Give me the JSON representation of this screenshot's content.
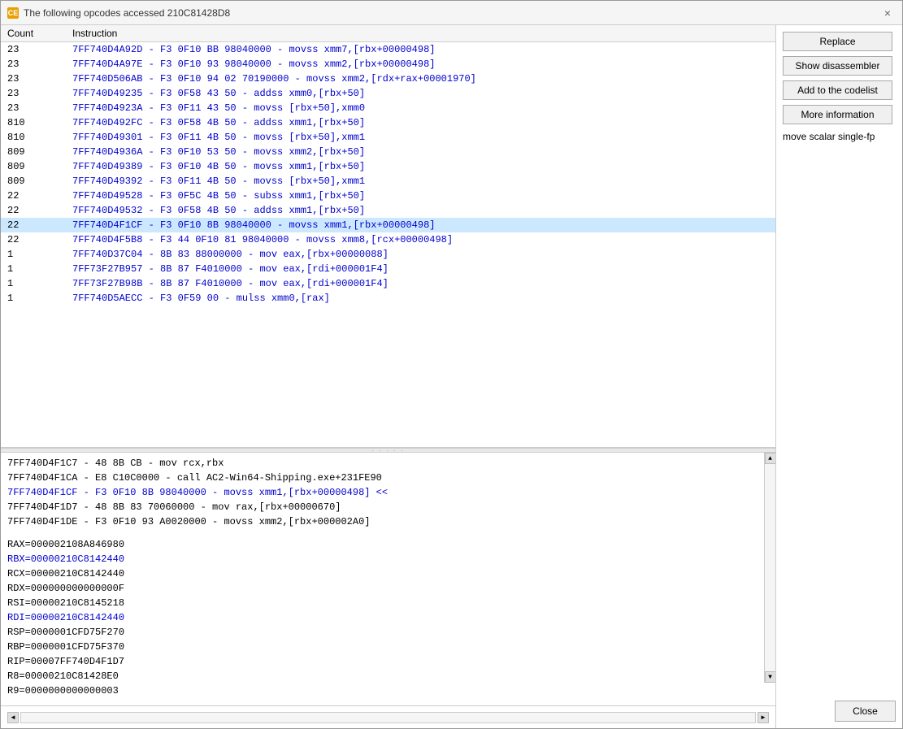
{
  "window": {
    "title": "The following opcodes accessed 210C81428D8",
    "title_icon": "CE",
    "close_label": "×"
  },
  "table": {
    "headers": [
      "Count",
      "Instruction"
    ],
    "rows": [
      {
        "count": "23",
        "instruction": "7FF740D4A92D - F3 0F10 BB 98040000  - movss xmm7,[rbx+00000498]",
        "highlighted": false
      },
      {
        "count": "23",
        "instruction": "7FF740D4A97E - F3 0F10 93 98040000  - movss xmm2,[rbx+00000498]",
        "highlighted": false
      },
      {
        "count": "23",
        "instruction": "7FF740D506AB - F3 0F10 94 02 70190000  - movss xmm2,[rdx+rax+00001970]",
        "highlighted": false
      },
      {
        "count": "23",
        "instruction": "7FF740D49235 - F3 0F58 43 50  - addss xmm0,[rbx+50]",
        "highlighted": false
      },
      {
        "count": "23",
        "instruction": "7FF740D4923A - F3 0F11 43 50  - movss [rbx+50],xmm0",
        "highlighted": false
      },
      {
        "count": "810",
        "instruction": "7FF740D492FC - F3 0F58 4B 50  - addss xmm1,[rbx+50]",
        "highlighted": false
      },
      {
        "count": "810",
        "instruction": "7FF740D49301 - F3 0F11 4B 50  - movss [rbx+50],xmm1",
        "highlighted": false
      },
      {
        "count": "809",
        "instruction": "7FF740D4936A - F3 0F10 53 50  - movss xmm2,[rbx+50]",
        "highlighted": false
      },
      {
        "count": "809",
        "instruction": "7FF740D49389 - F3 0F10 4B 50  - movss xmm1,[rbx+50]",
        "highlighted": false
      },
      {
        "count": "809",
        "instruction": "7FF740D49392 - F3 0F11 4B 50  - movss [rbx+50],xmm1",
        "highlighted": false
      },
      {
        "count": "22",
        "instruction": "7FF740D49528 - F3 0F5C 4B 50  - subss xmm1,[rbx+50]",
        "highlighted": false
      },
      {
        "count": "22",
        "instruction": "7FF740D49532 - F3 0F58 4B 50  - addss xmm1,[rbx+50]",
        "highlighted": false
      },
      {
        "count": "22",
        "instruction": "7FF740D4F1CF - F3 0F10 8B 98040000  - movss xmm1,[rbx+00000498]",
        "highlighted": true
      },
      {
        "count": "22",
        "instruction": "7FF740D4F5B8 - F3 44 0F10 81 98040000  - movss xmm8,[rcx+00000498]",
        "highlighted": false
      },
      {
        "count": "1",
        "instruction": "7FF740D37C04 - 8B 83 88000000  - mov eax,[rbx+00000088]",
        "highlighted": false
      },
      {
        "count": "1",
        "instruction": "7FF73F27B957 - 8B 87 F4010000  - mov eax,[rdi+000001F4]",
        "highlighted": false
      },
      {
        "count": "1",
        "instruction": "7FF73F27B98B - 8B 87 F4010000  - mov eax,[rdi+000001F4]",
        "highlighted": false
      },
      {
        "count": "1",
        "instruction": "7FF740D5AECC - F3 0F59 00  - mulss xmm0,[rax]",
        "highlighted": false
      }
    ]
  },
  "disasm": {
    "lines": [
      {
        "text": "7FF740D4F1C7 - 48 8B CB  - mov rcx,rbx",
        "type": "normal"
      },
      {
        "text": "7FF740D4F1CA - E8 C10C0000 - call AC2-Win64-Shipping.exe+231FE90",
        "type": "normal"
      },
      {
        "text": "7FF740D4F1CF - F3 0F10 8B 98040000  - movss xmm1,[rbx+00000498] <<",
        "type": "current"
      },
      {
        "text": "7FF740D4F1D7 - 48 8B 83 70060000  - mov rax,[rbx+00000670]",
        "type": "normal"
      },
      {
        "text": "7FF740D4F1DE - F3 0F10 93 A0020000  - movss xmm2,[rbx+000002A0]",
        "type": "normal"
      }
    ]
  },
  "registers": [
    {
      "label": "RAX=000002108A846980",
      "blue": false
    },
    {
      "label": "RBX=00000210C8142440",
      "blue": true
    },
    {
      "label": "RCX=00000210C8142440",
      "blue": false
    },
    {
      "label": "RDX=000000000000000F",
      "blue": false
    },
    {
      "label": "RSI=00000210C8145218",
      "blue": false
    },
    {
      "label": "RDI=00000210C8142440",
      "blue": true
    },
    {
      "label": "RSP=0000001CFD75F270",
      "blue": false
    },
    {
      "label": "RBP=0000001CFD75F370",
      "blue": false
    },
    {
      "label": "RIP=00007FF740D4F1D7",
      "blue": false
    },
    {
      "label": "R8=00000210C81428E0",
      "blue": false
    },
    {
      "label": "R9=0000000000000003",
      "blue": false
    }
  ],
  "buttons": {
    "replace": "Replace",
    "show_disassembler": "Show disassembler",
    "add_to_codelist": "Add to the codelist",
    "more_information": "More information",
    "more_info_desc": "move scalar single-fp",
    "close": "Close"
  }
}
